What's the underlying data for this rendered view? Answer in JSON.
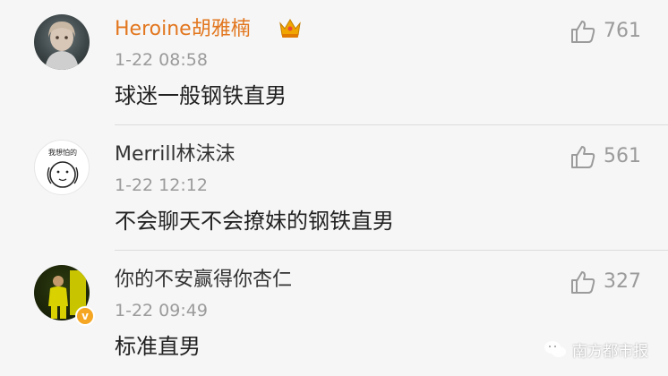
{
  "comments": [
    {
      "username": "Heroine胡雅楠",
      "timestamp": "1-22 08:58",
      "text": "球迷一般钢铁直男",
      "likes": "761",
      "badge_icon": "crown-icon"
    },
    {
      "username": "Merrill林沫沫",
      "timestamp": "1-22 12:12",
      "text": "不会聊天不会撩妹的钢铁直男",
      "likes": "561",
      "avatar_caption": "我想怕的"
    },
    {
      "username": "你的不安赢得你杏仁",
      "timestamp": "1-22 09:49",
      "text": "标准直男",
      "likes": "327",
      "badge_icon": "verified-v-icon"
    }
  ],
  "watermark": {
    "text": "南方都市报"
  },
  "colors": {
    "vip_name": "#e2761e",
    "name": "#333333",
    "meta": "#9b9b9b",
    "background": "#f6f6f6"
  }
}
